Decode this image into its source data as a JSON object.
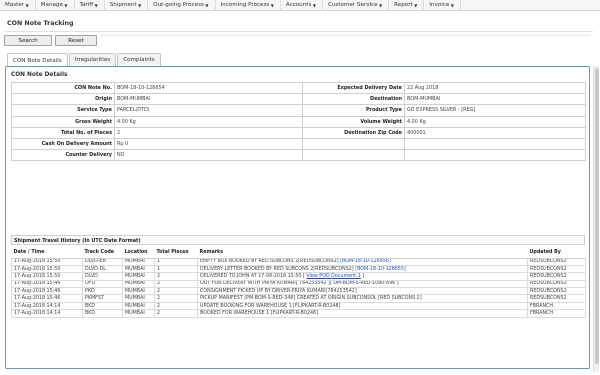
{
  "menu": [
    {
      "label": "Master"
    },
    {
      "label": "Manage"
    },
    {
      "label": "Tariff"
    },
    {
      "label": "Shipment"
    },
    {
      "label": "Out-going Process"
    },
    {
      "label": "Incoming Process"
    },
    {
      "label": "Accounts"
    },
    {
      "label": "Customer Service"
    },
    {
      "label": "Report"
    },
    {
      "label": "Invoice"
    }
  ],
  "page": {
    "title": "CON Note Tracking"
  },
  "buttons": {
    "search": "Search",
    "reset": "Reset"
  },
  "tabs": [
    {
      "label": "CON Note Details",
      "active": true
    },
    {
      "label": "Irregularities",
      "active": false
    },
    {
      "label": "Complaints",
      "active": false
    }
  ],
  "details": {
    "section_title": "CON Note Details",
    "rows": [
      {
        "l1": "CON Note No.",
        "v1": "BOM-18-10-126654",
        "l2": "Expected Delivery Date",
        "v2": "22 Aug 2018"
      },
      {
        "l1": "Origin",
        "v1": "BOM-MUMBAI",
        "l2": "Destination",
        "v2": "BOM-MUMBAI"
      },
      {
        "l1": "Service Type",
        "v1": "PARCEL(DTD)",
        "l2": "Product Type",
        "v2": "GD EXPRESS SILVER - [REG]"
      },
      {
        "l1": "Gross Weight",
        "v1": "4.00 Kg",
        "l2": "Volume Weight",
        "v2": "4.00 Kg"
      },
      {
        "l1": "Total No. of Pieces",
        "v1": "2",
        "l2": "Destination Zip Code",
        "v2": "400001"
      },
      {
        "l1": "Cash On Delivery Amount",
        "v1": "Rp 0",
        "l2": "",
        "v2": ""
      },
      {
        "l1": "Counter Delivery",
        "v1": "NO",
        "l2": "",
        "v2": ""
      }
    ]
  },
  "history": {
    "title": "Shipment Travel History (In UTC Date Format)",
    "headers": {
      "date": "Date / Time",
      "code": "Track Code",
      "location": "Location",
      "pieces": "Total Pieces",
      "remarks": "Remarks",
      "by": "Updated By"
    },
    "rows": [
      {
        "date": "17-Aug-2018 15:50",
        "code": "DLVD-EB",
        "location": "MUMBAI",
        "pieces": "1",
        "remarks": "EMPTY BOX BOOKED BY RED SUBCONS 2[REDSUBCONS2]",
        "link": "[BOM-18-10-126656]",
        "by": "REDSUBCONS2"
      },
      {
        "date": "17-Aug-2018 15:50",
        "code": "DLVD-DL",
        "location": "MUMBAI",
        "pieces": "1",
        "remarks": "DELIVERY LETTER BOOKED BY RED SUBCONS 2[REDSUBCONS2]",
        "link": "[BOM-18-10-126655]",
        "by": "REDSUBCONS2"
      },
      {
        "date": "17-Aug-2018 15:50",
        "code": "DLVD",
        "location": "MUMBAI",
        "pieces": "2",
        "remarks": "DELIVERED TO JOHN AT 17-08-2018 15:50",
        "link": "View POD Document-1",
        "by": "REDSUBCONS2"
      },
      {
        "date": "17-Aug-2018 15:46",
        "code": "OFD",
        "location": "MUMBAI",
        "pieces": "2",
        "remarks": "OUT FOR DELIVERY WITH PRIYA KUMARI[ 784253542 ][ DM-BOM-S-RED-1080-896 ]",
        "link": "",
        "by": "REDSUBCONS2"
      },
      {
        "date": "17-Aug-2018 15:46",
        "code": "PKD",
        "location": "MUMBAI",
        "pieces": "2",
        "remarks": "CONSIGNMENT PICKED UP BY DRIVER-PRIYA KUMARI[784253542]",
        "link": "",
        "by": "REDSUBCONS2"
      },
      {
        "date": "17-Aug-2018 15:46",
        "code": "PKMFST",
        "location": "MUMBAI",
        "pieces": "2",
        "remarks": "PICKUP MANIFEST [PM-BOM-S-RED-348] CREATED AT ORIGIN SUBCONSOL [RED SUBCONS 2]",
        "link": "",
        "by": "REDSUBCONS2"
      },
      {
        "date": "17-Aug-2018 14:14",
        "code": "BKD",
        "location": "MUMBAI",
        "pieces": "2",
        "remarks": "UPDATE BOOKING FOR WAREHOUSE 1 [FLIPKART-R-B0248]",
        "link": "",
        "by": "FBRANCH"
      },
      {
        "date": "17-Aug-2018 14:14",
        "code": "BKD",
        "location": "MUMBAI",
        "pieces": "2",
        "remarks": "BOOKED FOR WAREHOUSE 1 [FLIPKART-R-B0248]",
        "link": "",
        "by": "FBRANCH"
      }
    ]
  }
}
